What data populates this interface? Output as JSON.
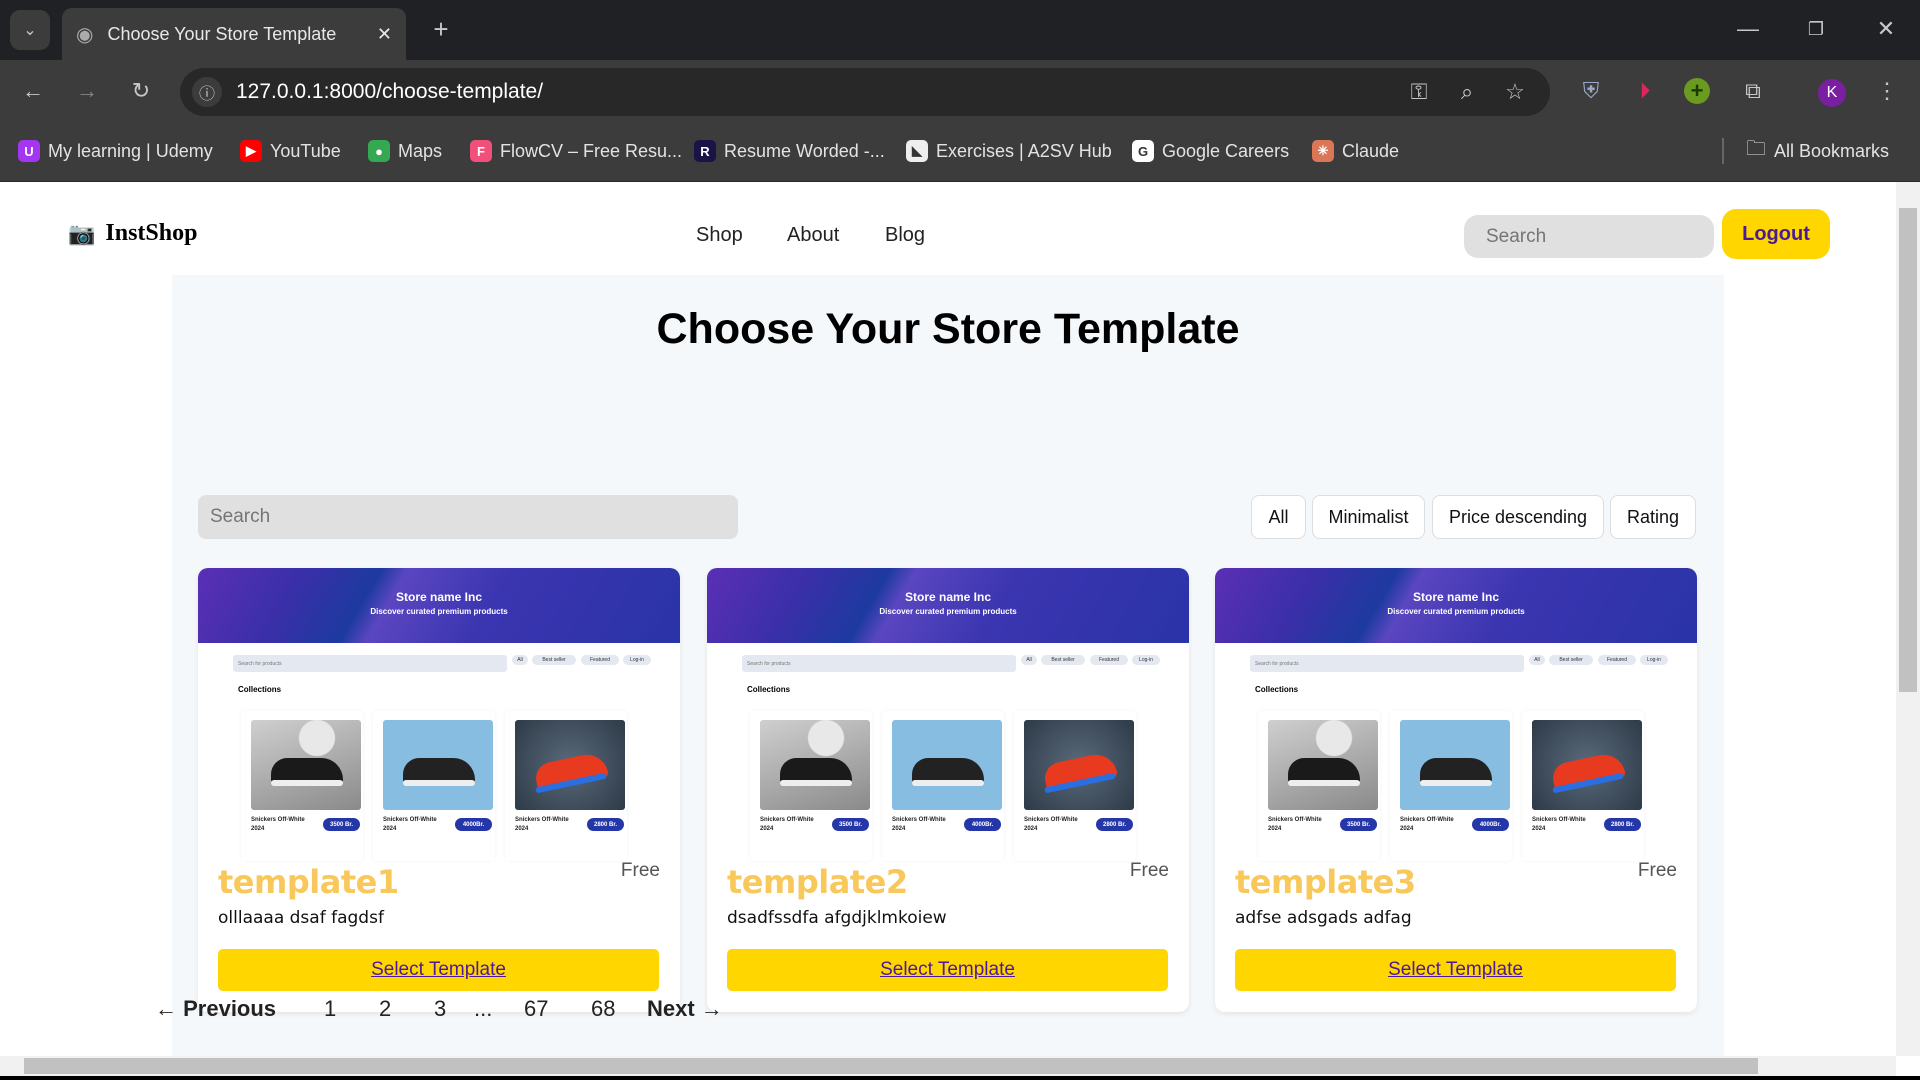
{
  "browser": {
    "tab_title": "Choose Your Store Template",
    "url": "127.0.0.1:8000/choose-template/",
    "bookmarks": [
      {
        "label": "My learning | Udemy",
        "icon": "udemy-icon",
        "color": "#a435f0",
        "glyph": "U"
      },
      {
        "label": "YouTube",
        "icon": "youtube-icon",
        "color": "#ff0000",
        "glyph": "▶"
      },
      {
        "label": "Maps",
        "icon": "maps-icon",
        "color": "#34a853",
        "glyph": "●"
      },
      {
        "label": "FlowCV – Free Resu...",
        "icon": "flowcv-icon",
        "color": "#f0507a",
        "glyph": "F"
      },
      {
        "label": "Resume Worded -...",
        "icon": "resume-worded-icon",
        "color": "#1a1446",
        "glyph": "R"
      },
      {
        "label": "Exercises | A2SV Hub",
        "icon": "a2sv-icon",
        "color": "#eeeeee",
        "glyph": "◣"
      },
      {
        "label": "Google Careers",
        "icon": "google-icon",
        "color": "#ffffff",
        "glyph": "G"
      },
      {
        "label": "Claude",
        "icon": "claude-icon",
        "color": "#d97757",
        "glyph": "✳"
      }
    ],
    "all_bookmarks": "All Bookmarks",
    "profile_initial": "K"
  },
  "header": {
    "logo": "InstShop",
    "nav": [
      "Shop",
      "About",
      "Blog"
    ],
    "search_placeholder": "Search",
    "logout": "Logout"
  },
  "main": {
    "title": "Choose Your Store Template",
    "search_placeholder": "Search",
    "filters": [
      "All",
      "Minimalist",
      "Price descending",
      "Rating"
    ]
  },
  "preview": {
    "store_name": "Store name Inc",
    "tagline": "Discover curated premium products",
    "search_placeholder": "Search for products",
    "chips": [
      "All",
      "Best seller",
      "Featured",
      "Log-in"
    ],
    "collections": "Collections",
    "products": [
      {
        "name": "Snickers Off-White 2024",
        "price": "3500 Br."
      },
      {
        "name": "Snickers Off-White 2024",
        "price": "4000Br."
      },
      {
        "name": "Snickers Off-White 2024",
        "price": "2800 Br."
      }
    ]
  },
  "templates": [
    {
      "name": "template1",
      "price": "Free",
      "description": "olllaaaa dsaf fagdsf",
      "button": "Select Template"
    },
    {
      "name": "template2",
      "price": "Free",
      "description": "dsadfssdfa afgdjklmkoiew",
      "button": "Select Template"
    },
    {
      "name": "template3",
      "price": "Free",
      "description": "adfse adsgads adfag",
      "button": "Select Template"
    }
  ],
  "pagination": {
    "previous": "← Previous",
    "pages": [
      "1",
      "2",
      "3",
      "...",
      "67",
      "68"
    ],
    "next": "Next →"
  },
  "colors": {
    "accent": "#ffd600",
    "template_name": "#f9c85a",
    "logout_text": "#4b1a9a",
    "price_badge": "#2537a8"
  }
}
